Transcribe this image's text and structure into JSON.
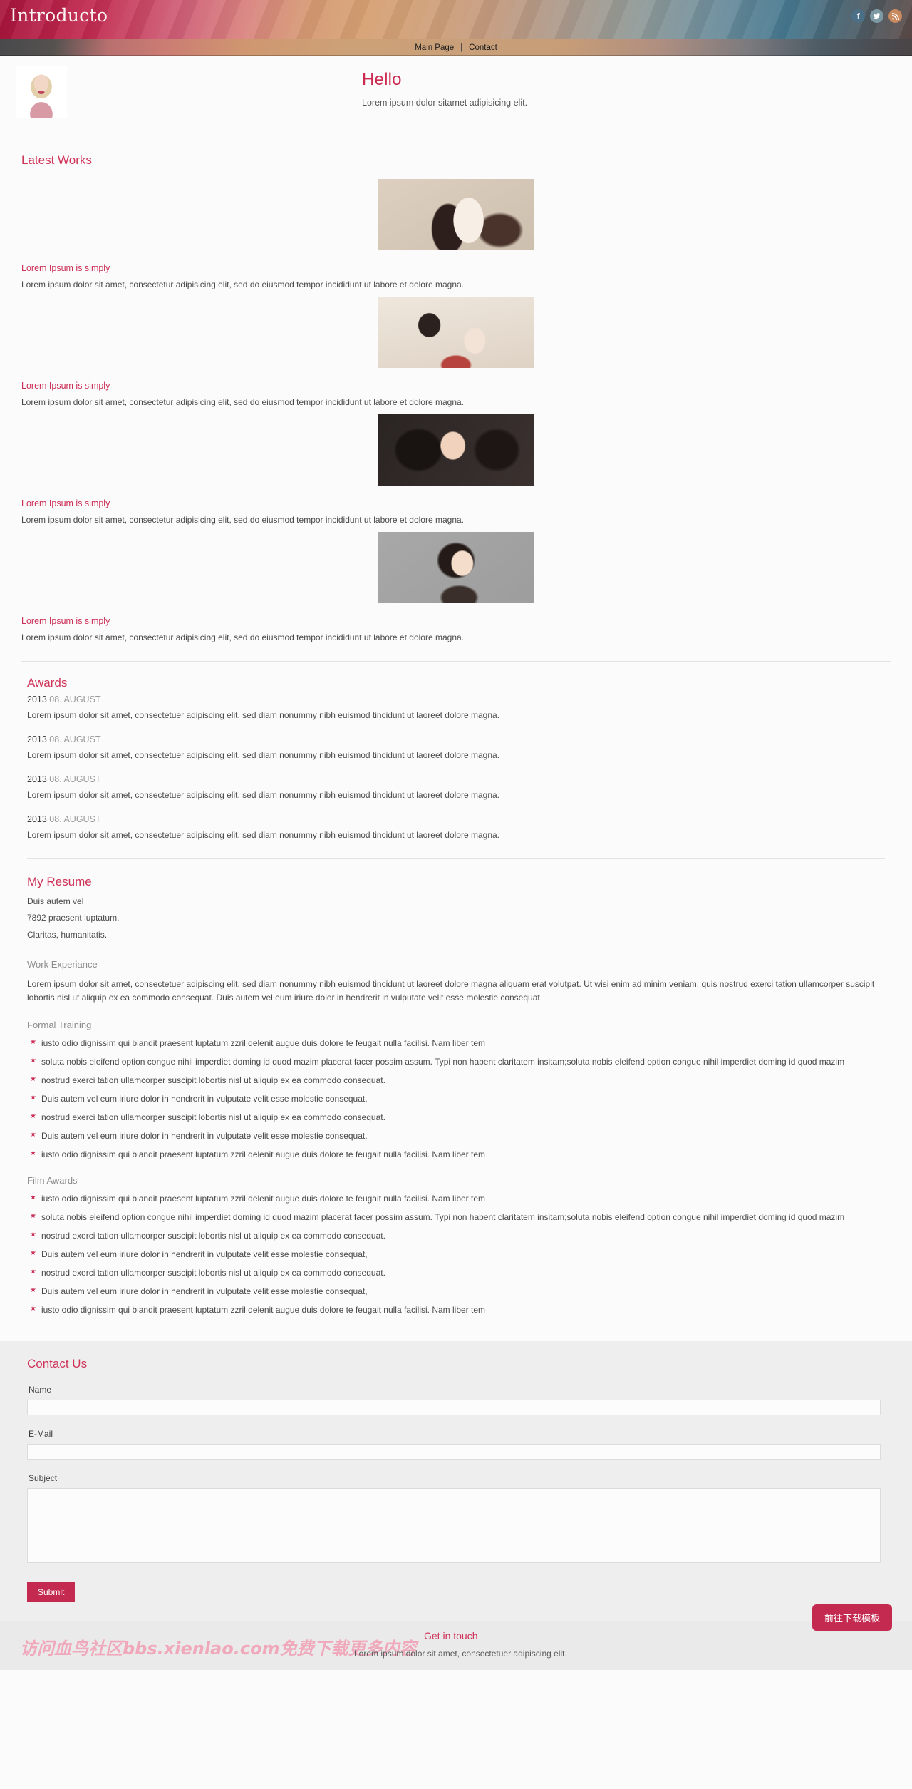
{
  "header": {
    "logo": "Introducto",
    "social": [
      {
        "name": "facebook-icon",
        "glyph": "f"
      },
      {
        "name": "twitter-icon",
        "glyph": "•"
      },
      {
        "name": "rss-icon",
        "glyph": "◔"
      }
    ]
  },
  "nav": {
    "items": [
      "Main Page",
      "Contact"
    ],
    "separator": "|"
  },
  "hero": {
    "title": "Hello",
    "subtitle": "Lorem ipsum dolor sitamet adipisicing elit."
  },
  "latest_works": {
    "heading": "Latest Works",
    "items": [
      {
        "title": "Lorem Ipsum is simply",
        "body": "Lorem ipsum dolor sit amet, consectetur adipisicing elit, sed do eiusmod tempor incididunt ut labore et dolore magna."
      },
      {
        "title": "Lorem Ipsum is simply",
        "body": "Lorem ipsum dolor sit amet, consectetur adipisicing elit, sed do eiusmod tempor incididunt ut labore et dolore magna."
      },
      {
        "title": "Lorem Ipsum is simply",
        "body": "Lorem ipsum dolor sit amet, consectetur adipisicing elit, sed do eiusmod tempor incididunt ut labore et dolore magna."
      },
      {
        "title": "Lorem Ipsum is simply",
        "body": "Lorem ipsum dolor sit amet, consectetur adipisicing elit, sed do eiusmod tempor incididunt ut labore et dolore magna."
      }
    ]
  },
  "awards": {
    "heading": "Awards",
    "items": [
      {
        "year": "2013",
        "month": "08. AUGUST",
        "body": "Lorem ipsum dolor sit amet, consectetuer adipiscing elit, sed diam nonummy nibh euismod tincidunt ut laoreet dolore magna."
      },
      {
        "year": "2013",
        "month": "08. AUGUST",
        "body": "Lorem ipsum dolor sit amet, consectetuer adipiscing elit, sed diam nonummy nibh euismod tincidunt ut laoreet dolore magna."
      },
      {
        "year": "2013",
        "month": "08. AUGUST",
        "body": "Lorem ipsum dolor sit amet, consectetuer adipiscing elit, sed diam nonummy nibh euismod tincidunt ut laoreet dolore magna."
      },
      {
        "year": "2013",
        "month": "08. AUGUST",
        "body": "Lorem ipsum dolor sit amet, consectetuer adipiscing elit, sed diam nonummy nibh euismod tincidunt ut laoreet dolore magna."
      }
    ]
  },
  "resume": {
    "heading": "My Resume",
    "address_line1": "Duis autem vel",
    "address_line2": "7892 praesent luptatum,",
    "address_line3": "Claritas, humanitatis.",
    "work_heading": "Work Experiance",
    "work_body": "Lorem ipsum dolor sit amet, consectetuer adipiscing elit, sed diam nonummy nibh euismod tincidunt ut laoreet dolore magna aliquam erat volutpat. Ut wisi enim ad minim veniam, quis nostrud exerci tation ullamcorper suscipit lobortis nisl ut aliquip ex ea commodo consequat. Duis autem vel eum iriure dolor in hendrerit in vulputate velit esse molestie consequat,",
    "formal_heading": "Formal Training",
    "formal_items": [
      "iusto odio dignissim qui blandit praesent luptatum zzril delenit augue duis dolore te feugait nulla facilisi. Nam liber tem",
      "soluta nobis eleifend option congue nihil imperdiet doming id quod mazim placerat facer possim assum. Typi non habent claritatem insitam;soluta nobis eleifend option congue nihil imperdiet doming id quod mazim",
      "nostrud exerci tation ullamcorper suscipit lobortis nisl ut aliquip ex ea commodo consequat.",
      "Duis autem vel eum iriure dolor in hendrerit in vulputate velit esse molestie consequat,",
      "nostrud exerci tation ullamcorper suscipit lobortis nisl ut aliquip ex ea commodo consequat.",
      "Duis autem vel eum iriure dolor in hendrerit in vulputate velit esse molestie consequat,",
      "iusto odio dignissim qui blandit praesent luptatum zzril delenit augue duis dolore te feugait nulla facilisi. Nam liber tem"
    ],
    "film_heading": "Film Awards",
    "film_items": [
      "iusto odio dignissim qui blandit praesent luptatum zzril delenit augue duis dolore te feugait nulla facilisi. Nam liber tem",
      "soluta nobis eleifend option congue nihil imperdiet doming id quod mazim placerat facer possim assum. Typi non habent claritatem insitam;soluta nobis eleifend option congue nihil imperdiet doming id quod mazim",
      "nostrud exerci tation ullamcorper suscipit lobortis nisl ut aliquip ex ea commodo consequat.",
      "Duis autem vel eum iriure dolor in hendrerit in vulputate velit esse molestie consequat,",
      "nostrud exerci tation ullamcorper suscipit lobortis nisl ut aliquip ex ea commodo consequat.",
      "Duis autem vel eum iriure dolor in hendrerit in vulputate velit esse molestie consequat,",
      "iusto odio dignissim qui blandit praesent luptatum zzril delenit augue duis dolore te feugait nulla facilisi. Nam liber tem"
    ]
  },
  "contact": {
    "heading": "Contact Us",
    "name_label": "Name",
    "name_value": "",
    "email_label": "E-Mail",
    "email_value": "",
    "subject_label": "Subject",
    "subject_value": "",
    "submit_label": "Submit"
  },
  "footer": {
    "watermark": "访问血鸟社区bbs.xienlao.com免费下载更多内容",
    "heading": "Get in touch",
    "body": "Lorem ipsum dolor sit amet, consectetuer adipiscing elit."
  },
  "floating": {
    "download_label": "前往下载模板"
  },
  "colors": {
    "accent": "#cc2f56",
    "accent_dark": "#c42a50",
    "muted": "#8c8c8c",
    "contact_bg": "#eeeeee"
  }
}
